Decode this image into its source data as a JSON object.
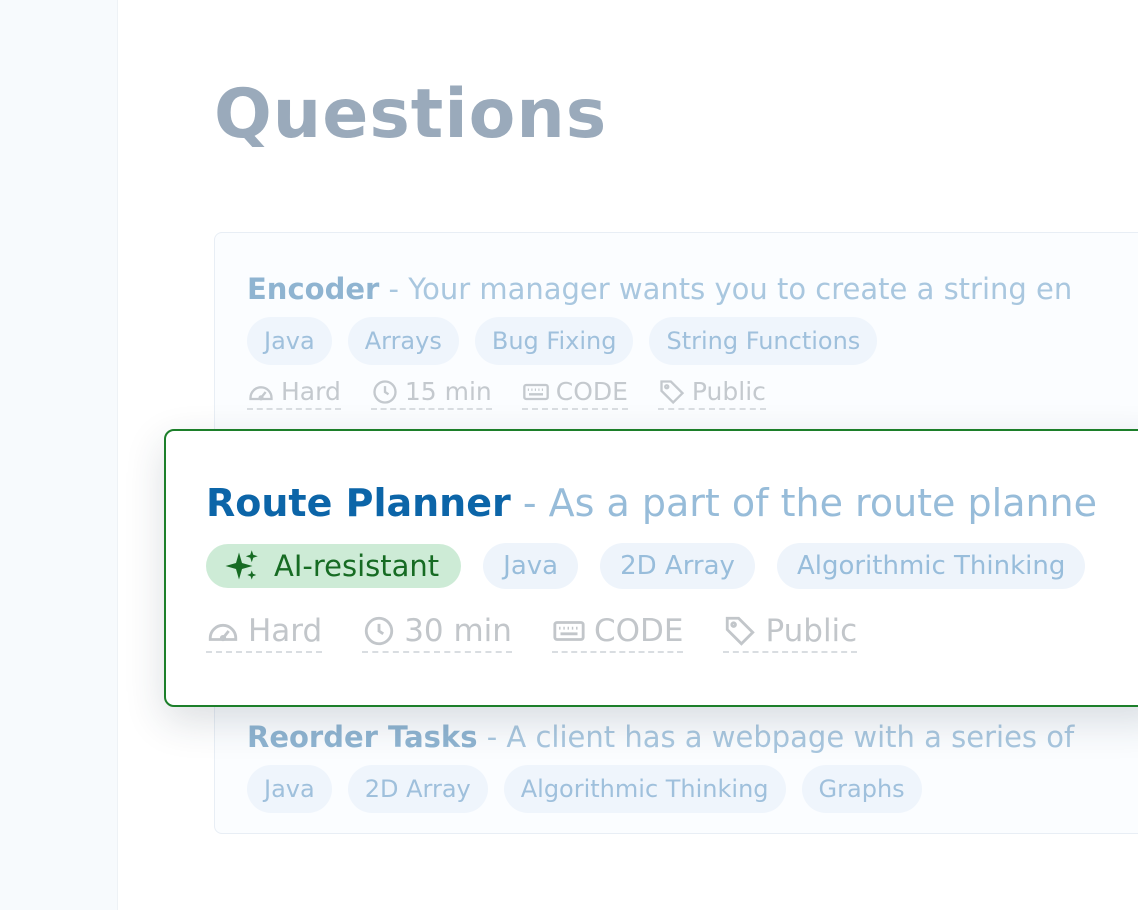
{
  "page": {
    "title": "Questions"
  },
  "questions": [
    {
      "name": "Encoder",
      "separator": "-",
      "description": "Your manager wants you to create a string en",
      "tags": [
        "Java",
        "Arrays",
        "Bug Fixing",
        "String Functions"
      ],
      "difficulty": "Hard",
      "duration": "15 min",
      "type": "CODE",
      "visibility": "Public"
    },
    {
      "name": "Route Planner",
      "separator": "-",
      "description": "As a part of the route planne",
      "badge": "AI-resistant",
      "tags": [
        "Java",
        "2D Array",
        "Algorithmic Thinking"
      ],
      "difficulty": "Hard",
      "duration": "30 min",
      "type": "CODE",
      "visibility": "Public"
    },
    {
      "name": "Reorder Tasks",
      "separator": "-",
      "description": "A client has a webpage with a series of",
      "tags": [
        "Java",
        "2D Array",
        "Algorithmic Thinking",
        "Graphs"
      ]
    }
  ],
  "colors": {
    "highlight_border": "#1c7f2a",
    "title_link": "#0c65a8",
    "ai_badge_bg": "#cdebd6",
    "ai_badge_text": "#166b23",
    "tag_bg": "#eff5fc"
  },
  "icons": {
    "difficulty": "gauge-icon",
    "duration": "clock-icon",
    "type": "keyboard-icon",
    "visibility": "tag-icon",
    "ai": "sparkles-icon"
  }
}
